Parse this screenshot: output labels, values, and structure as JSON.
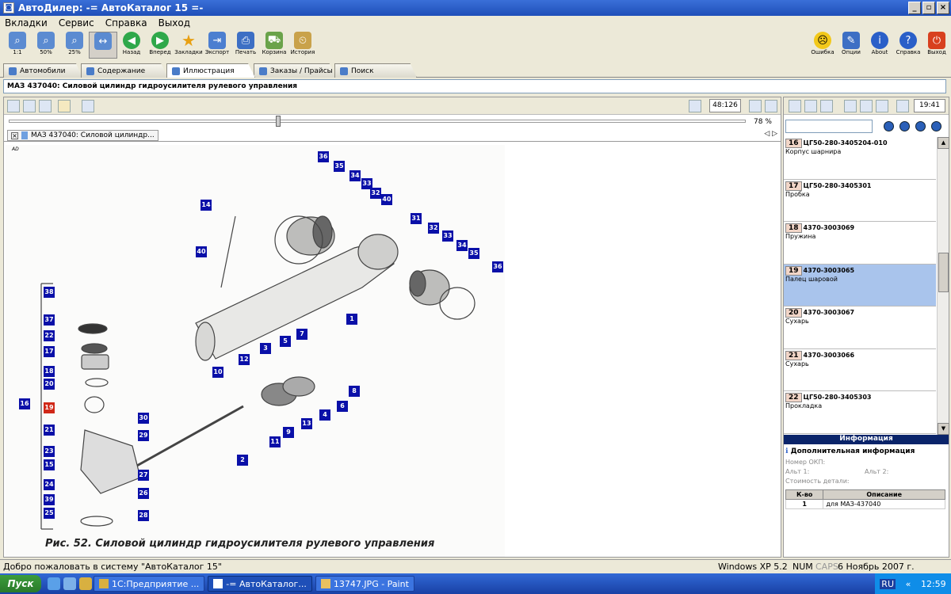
{
  "window": {
    "title": "АвтоДилер: -= АвтоКаталог 15 =-"
  },
  "menu": [
    "Вкладки",
    "Сервис",
    "Справка",
    "Выход"
  ],
  "toolbar": {
    "left": [
      {
        "label": "1:1",
        "icon": "zoom-1-1-icon"
      },
      {
        "label": "50%",
        "icon": "zoom-50-icon"
      },
      {
        "label": "25%",
        "icon": "zoom-25-icon"
      },
      {
        "label": "",
        "icon": "fit-width-icon"
      },
      {
        "label": "Назад",
        "icon": "back-arrow-icon"
      },
      {
        "label": "Вперед",
        "icon": "forward-arrow-icon"
      },
      {
        "label": "Закладки",
        "icon": "star-icon"
      },
      {
        "label": "Экспорт",
        "icon": "export-icon"
      },
      {
        "label": "Печать",
        "icon": "printer-icon"
      },
      {
        "label": "Корзина",
        "icon": "cart-icon"
      },
      {
        "label": "История",
        "icon": "history-icon"
      }
    ],
    "right": [
      {
        "label": "Ошибка",
        "icon": "smiley-icon"
      },
      {
        "label": "Опции",
        "icon": "options-icon"
      },
      {
        "label": "About",
        "icon": "info-icon"
      },
      {
        "label": "Справка",
        "icon": "help-icon"
      },
      {
        "label": "Выход",
        "icon": "power-icon"
      }
    ]
  },
  "tabs": [
    "Автомобили",
    "Содержание",
    "Иллюстрация",
    "Заказы / Прайсы",
    "Поиск"
  ],
  "active_tab": "Иллюстрация",
  "header": "МАЗ 437040: Силовой цилиндр гидроусилителя рулевого управления",
  "left": {
    "counter": "48:126",
    "zoom": "78 %",
    "doc_tab": "МАЗ 437040: Силовой цилиндр...",
    "doc_tab_close": "×",
    "nav_arrows": "◁ ▷",
    "corner_mark": "AD",
    "caption": "Рис. 52. Силовой цилиндр гидроусилителя рулевого управления"
  },
  "right": {
    "time": "19:41",
    "items": [
      {
        "num": "16",
        "code": "ЦГ50-280-3405204-010",
        "name": "Корпус шарнира"
      },
      {
        "num": "17",
        "code": "ЦГ50-280-3405301",
        "name": "Пробка"
      },
      {
        "num": "18",
        "code": "4370-3003069",
        "name": "Пружина"
      },
      {
        "num": "19",
        "code": "4370-3003065",
        "name": "Палец шаровой"
      },
      {
        "num": "20",
        "code": "4370-3003067",
        "name": "Сухарь"
      },
      {
        "num": "21",
        "code": "4370-3003066",
        "name": "Сухарь"
      },
      {
        "num": "22",
        "code": "ЦГ50-280-3405303",
        "name": "Прокладка"
      }
    ],
    "selected_item": "19",
    "info_header": "Информация",
    "info_title": "Дополнительная информация",
    "okp_label": "Номер ОКП:",
    "alt1_label": "Альт 1:",
    "alt2_label": "Альт 2:",
    "cost_label": "Стоимость детали:",
    "qty_head": "К-во",
    "desc_head": "Описание",
    "qty": "1",
    "desc": "для МАЗ-437040"
  },
  "status": {
    "msg": "Добро пожаловать в систему \"АвтоКаталог 15\"",
    "os": "Windows XP 5.2",
    "num": "NUM",
    "caps": "CAPS",
    "datetime": "6 Ноябрь 2007 г. 12:59:16"
  },
  "taskbar": {
    "start": "Пуск",
    "tasks": [
      "1С:Предприятие ...",
      "-= АвтоКаталог...",
      "13747.JPG - Paint"
    ],
    "lang": "RU",
    "clock": "12:59",
    "chevron": "«"
  },
  "callouts": [
    "36",
    "35",
    "34",
    "33",
    "32",
    "40",
    "14",
    "40",
    "31",
    "32",
    "33",
    "34",
    "35",
    "36",
    "38",
    "1",
    "37",
    "22",
    "17",
    "18",
    "20",
    "16",
    "19",
    "21",
    "23",
    "15",
    "24",
    "39",
    "25",
    "30",
    "29",
    "27",
    "26",
    "28",
    "10",
    "12",
    "3",
    "5",
    "7",
    "8",
    "6",
    "4",
    "13",
    "9",
    "11",
    "2"
  ]
}
